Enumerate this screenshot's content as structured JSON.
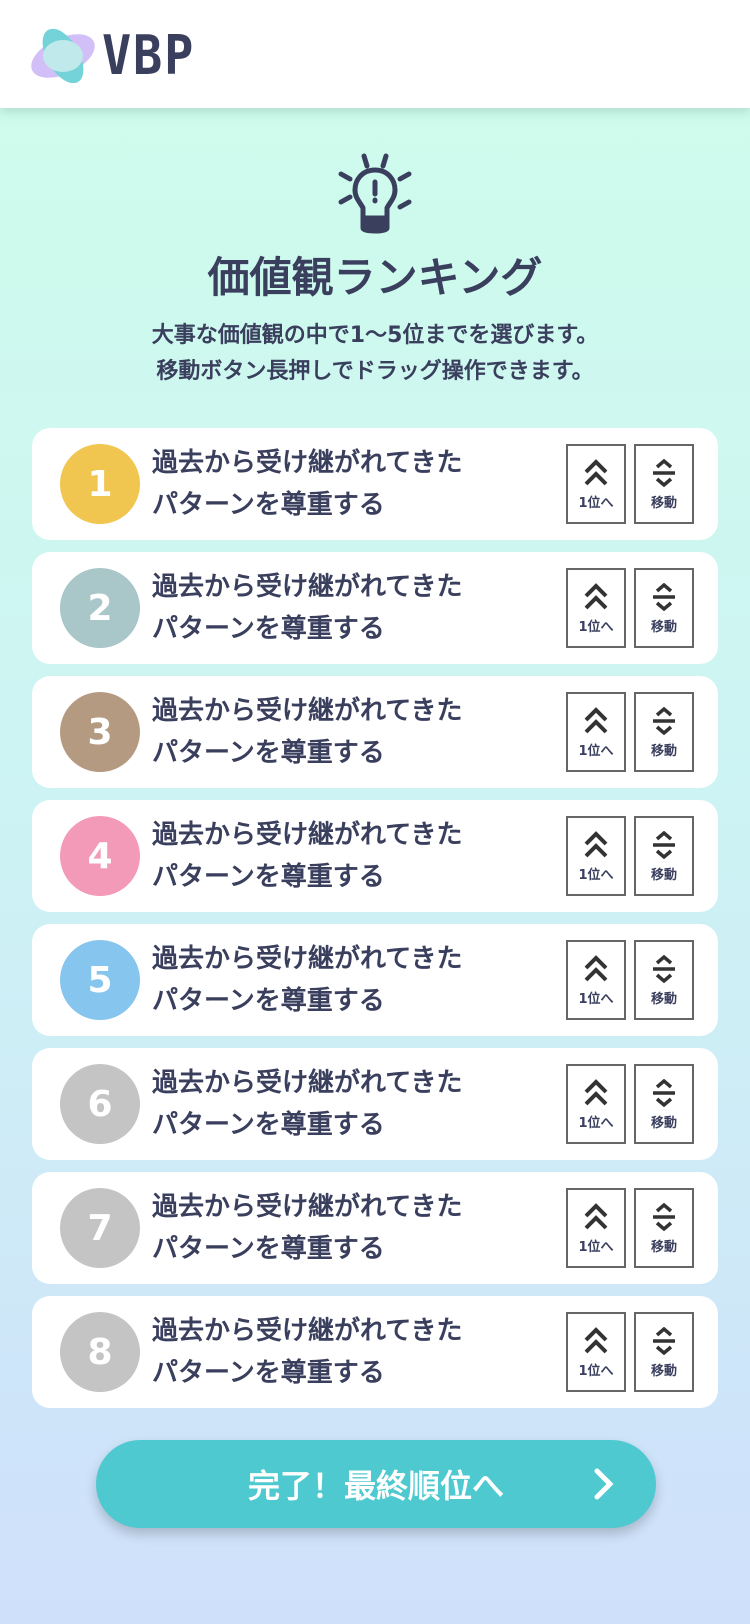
{
  "header": {
    "logo_text": "VBP"
  },
  "intro": {
    "title": "価値観ランキング",
    "desc_line1": "大事な価値観の中で1〜5位までを選びます。",
    "desc_line2": "移動ボタン長押しでドラッグ操作できます。"
  },
  "buttons": {
    "top_label": "1位へ",
    "move_label": "移動"
  },
  "items": [
    {
      "rank": "1",
      "line1": "過去から受け継がれてきた",
      "line2": "パターンを尊重する",
      "color": "#f0c650"
    },
    {
      "rank": "2",
      "line1": "過去から受け継がれてきた",
      "line2": "パターンを尊重する",
      "color": "#a9c6c8"
    },
    {
      "rank": "3",
      "line1": "過去から受け継がれてきた",
      "line2": "パターンを尊重する",
      "color": "#b59a82"
    },
    {
      "rank": "4",
      "line1": "過去から受け継がれてきた",
      "line2": "パターンを尊重する",
      "color": "#f39ab9"
    },
    {
      "rank": "5",
      "line1": "過去から受け継がれてきた",
      "line2": "パターンを尊重する",
      "color": "#86c5ee"
    },
    {
      "rank": "6",
      "line1": "過去から受け継がれてきた",
      "line2": "パターンを尊重する",
      "color": "#c4c4c4"
    },
    {
      "rank": "7",
      "line1": "過去から受け継がれてきた",
      "line2": "パターンを尊重する",
      "color": "#c4c4c4"
    },
    {
      "rank": "8",
      "line1": "過去から受け継がれてきた",
      "line2": "パターンを尊重する",
      "color": "#c4c4c4"
    }
  ],
  "footer": {
    "done_label": "完了！最終順位へ"
  }
}
